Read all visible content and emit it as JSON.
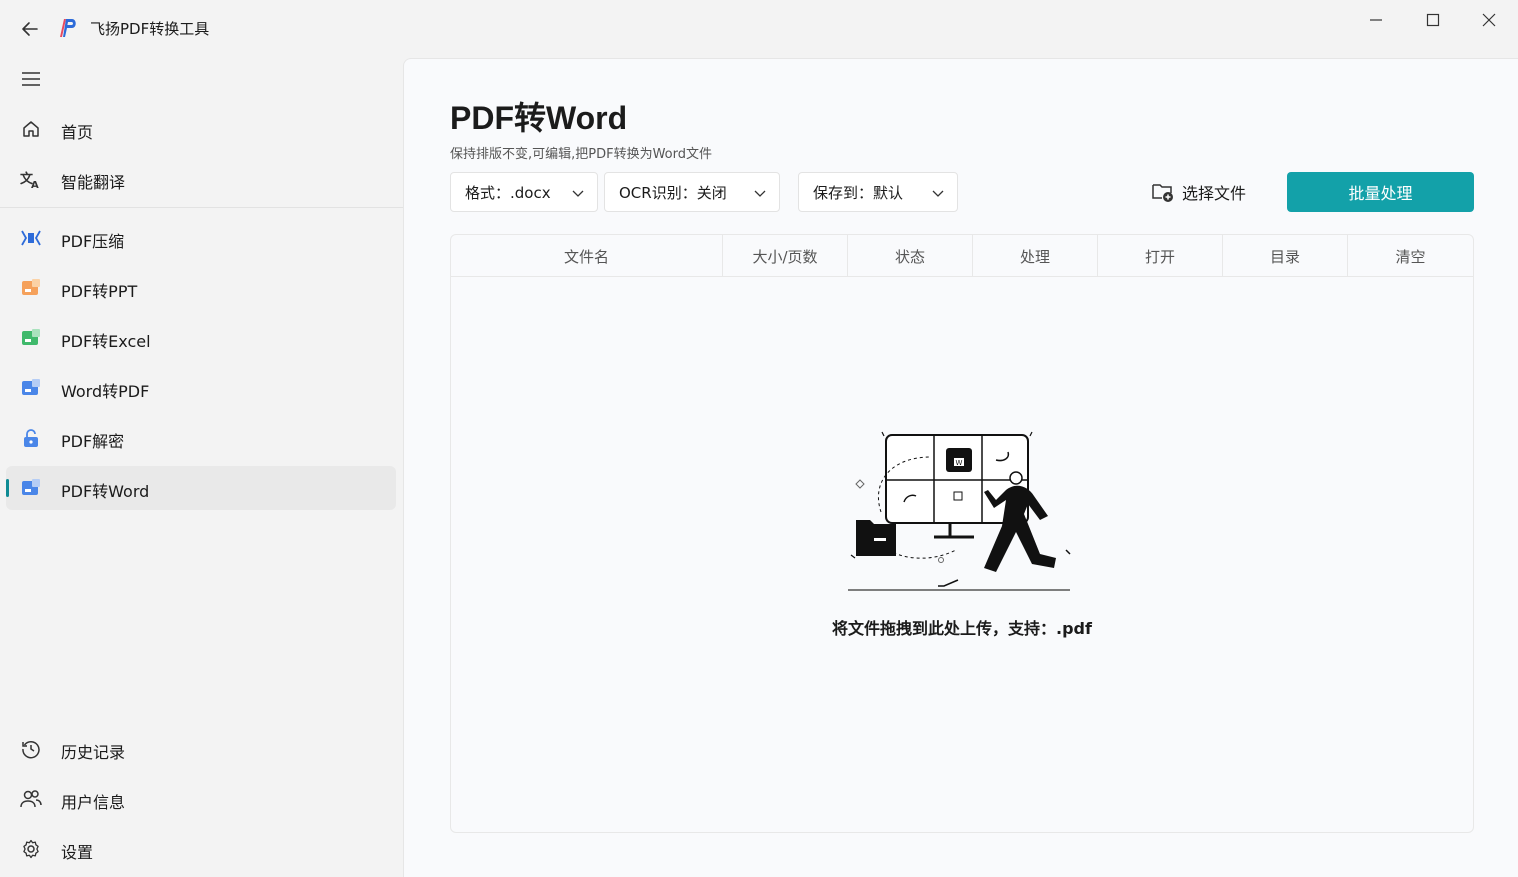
{
  "app": {
    "title": "飞扬PDF转换工具",
    "accent_color": "#13a1a9"
  },
  "sidebar": {
    "items": [
      {
        "label": "首页",
        "icon": "home-icon"
      },
      {
        "label": "智能翻译",
        "icon": "translate-icon"
      },
      {
        "label": "PDF压缩",
        "icon": "compress-icon"
      },
      {
        "label": "PDF转PPT",
        "icon": "ppt-icon"
      },
      {
        "label": "PDF转Excel",
        "icon": "excel-icon"
      },
      {
        "label": "Word转PDF",
        "icon": "word-icon"
      },
      {
        "label": "PDF解密",
        "icon": "unlock-icon"
      },
      {
        "label": "PDF转Word",
        "icon": "word-icon",
        "active": true
      }
    ],
    "bottom_items": [
      {
        "label": "历史记录",
        "icon": "history-icon"
      },
      {
        "label": "用户信息",
        "icon": "users-icon"
      },
      {
        "label": "设置",
        "icon": "gear-icon"
      }
    ]
  },
  "main": {
    "title": "PDF转Word",
    "subtitle": "保持排版不变,可编辑,把PDF转换为Word文件",
    "format_select": "格式：.docx",
    "ocr_select": "OCR识别：关闭",
    "save_select": "保存到：默认",
    "select_file_label": "选择文件",
    "batch_label": "批量处理",
    "table_headers": [
      "文件名",
      "大小/页数",
      "状态",
      "处理",
      "打开",
      "目录",
      "清空"
    ],
    "empty_text": "将文件拖拽到此处上传，支持：.pdf"
  }
}
